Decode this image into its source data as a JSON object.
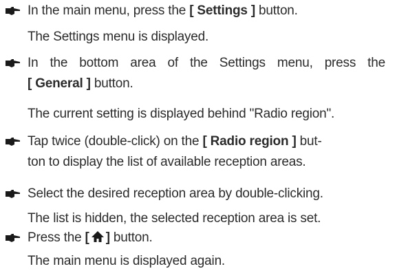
{
  "steps": [
    {
      "instruction_before": "In the main menu, press the ",
      "instruction_button": "[ Settings ]",
      "instruction_after": " button.",
      "result": "The Settings menu is displayed."
    },
    {
      "instruction_line1": "In the bottom area of the Settings menu, press the",
      "instruction_button": "[ General ]",
      "instruction_after": " button.",
      "result": "The current setting is displayed behind \"Radio region\"."
    },
    {
      "instruction_before": "Tap twice (double-click) on the ",
      "instruction_button": "[ Radio region ]",
      "instruction_after": " but-",
      "instruction_line2": "ton to display the list of available reception areas."
    },
    {
      "instruction": "Select the desired reception area by double-clicking.",
      "result": "The list is hidden, the selected reception area is set."
    },
    {
      "instruction_before": "Press the ",
      "instruction_button_open": "[",
      "instruction_button_icon": "home-icon",
      "instruction_button_close": "]",
      "instruction_after": " button.",
      "result": "The main menu is displayed again."
    }
  ],
  "colors": {
    "text": "#2b2b2b",
    "bullet": "#1a1a1a"
  }
}
